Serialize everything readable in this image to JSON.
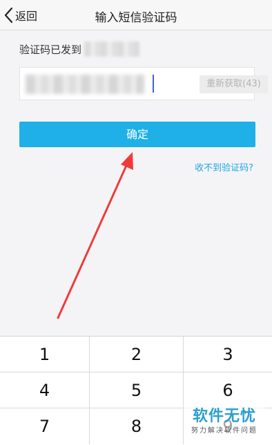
{
  "nav": {
    "back_label": "返回",
    "title": "输入短信验证码"
  },
  "form": {
    "sent_to_label": "验证码已发到",
    "code_value": "",
    "resend_label": "重新获取(43)",
    "confirm_label": "确定",
    "help_link": "收不到验证码?"
  },
  "keypad": {
    "keys": [
      "1",
      "2",
      "3",
      "4",
      "5",
      "6",
      "7",
      "8",
      "9"
    ]
  },
  "watermark": {
    "title": "软件无忧",
    "subtitle": "努力解决软件问题"
  },
  "colors": {
    "accent": "#1fb0e8",
    "link": "#1fa7e0",
    "arrow": "#f03a3a",
    "caret": "#3a62d6"
  }
}
